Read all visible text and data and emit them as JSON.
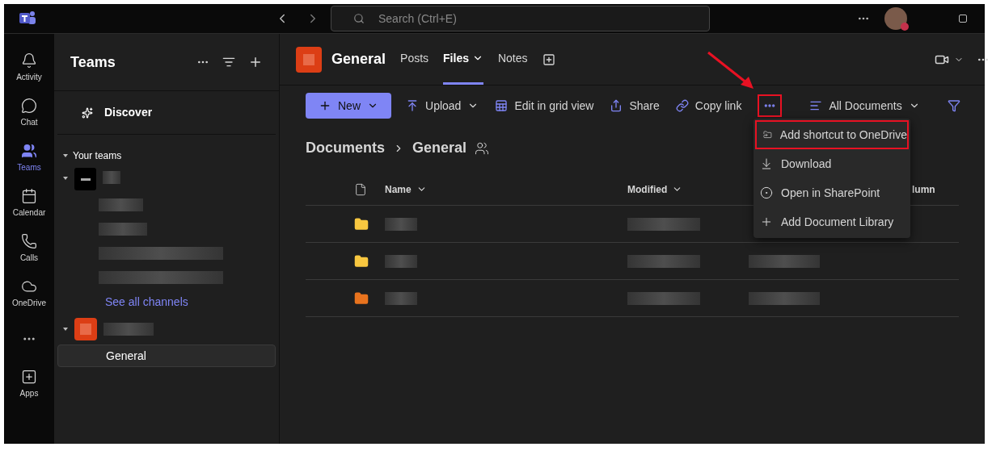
{
  "titlebar": {
    "search": {
      "placeholder": "Search (Ctrl+E)"
    }
  },
  "rail": [
    {
      "kind": "bell",
      "label": "Activity",
      "selected": false
    },
    {
      "kind": "chat",
      "label": "Chat",
      "selected": false
    },
    {
      "kind": "teams",
      "label": "Teams",
      "selected": true
    },
    {
      "kind": "calendar",
      "label": "Calendar",
      "selected": false
    },
    {
      "kind": "calls",
      "label": "Calls",
      "selected": false
    },
    {
      "kind": "cloud",
      "label": "OneDrive",
      "selected": false
    },
    {
      "kind": "more"
    },
    {
      "kind": "apps",
      "label": "Apps",
      "selected": false
    }
  ],
  "teams_panel": {
    "title": "Teams",
    "discover": "Discover",
    "section": "Your teams",
    "see_all": "See all channels",
    "channels": [
      {
        "name": "General",
        "selected": true
      }
    ]
  },
  "channel": {
    "title": "General",
    "tabs": [
      {
        "label": "Posts",
        "selected": false,
        "caret": false
      },
      {
        "label": "Files",
        "selected": true,
        "caret": true
      },
      {
        "label": "Notes",
        "selected": false,
        "caret": false
      }
    ]
  },
  "toolbar": [
    {
      "kind": "new",
      "label": "New"
    },
    {
      "kind": "upload",
      "label": "Upload"
    },
    {
      "kind": "grid",
      "label": "Edit in grid view"
    },
    {
      "kind": "share",
      "label": "Share"
    },
    {
      "kind": "link",
      "label": "Copy link"
    },
    {
      "kind": "more",
      "highlighted": true
    },
    {
      "kind": "view",
      "label": "All Documents"
    }
  ],
  "breadcrumb": [
    "Documents",
    "General"
  ],
  "table": {
    "columns": [
      "Name",
      "Modified",
      "lumn"
    ],
    "rows": [
      {
        "color": "#f8c740"
      },
      {
        "color": "#f8c740"
      },
      {
        "color": "#e8731e"
      }
    ]
  },
  "menu": [
    {
      "kind": "shortcut",
      "label": "Add shortcut to OneDrive",
      "highlighted": true
    },
    {
      "kind": "download",
      "label": "Download",
      "highlighted": false
    },
    {
      "kind": "sharepoint",
      "label": "Open in SharePoint",
      "highlighted": false
    },
    {
      "kind": "add",
      "label": "Add Document Library",
      "highlighted": false
    }
  ]
}
